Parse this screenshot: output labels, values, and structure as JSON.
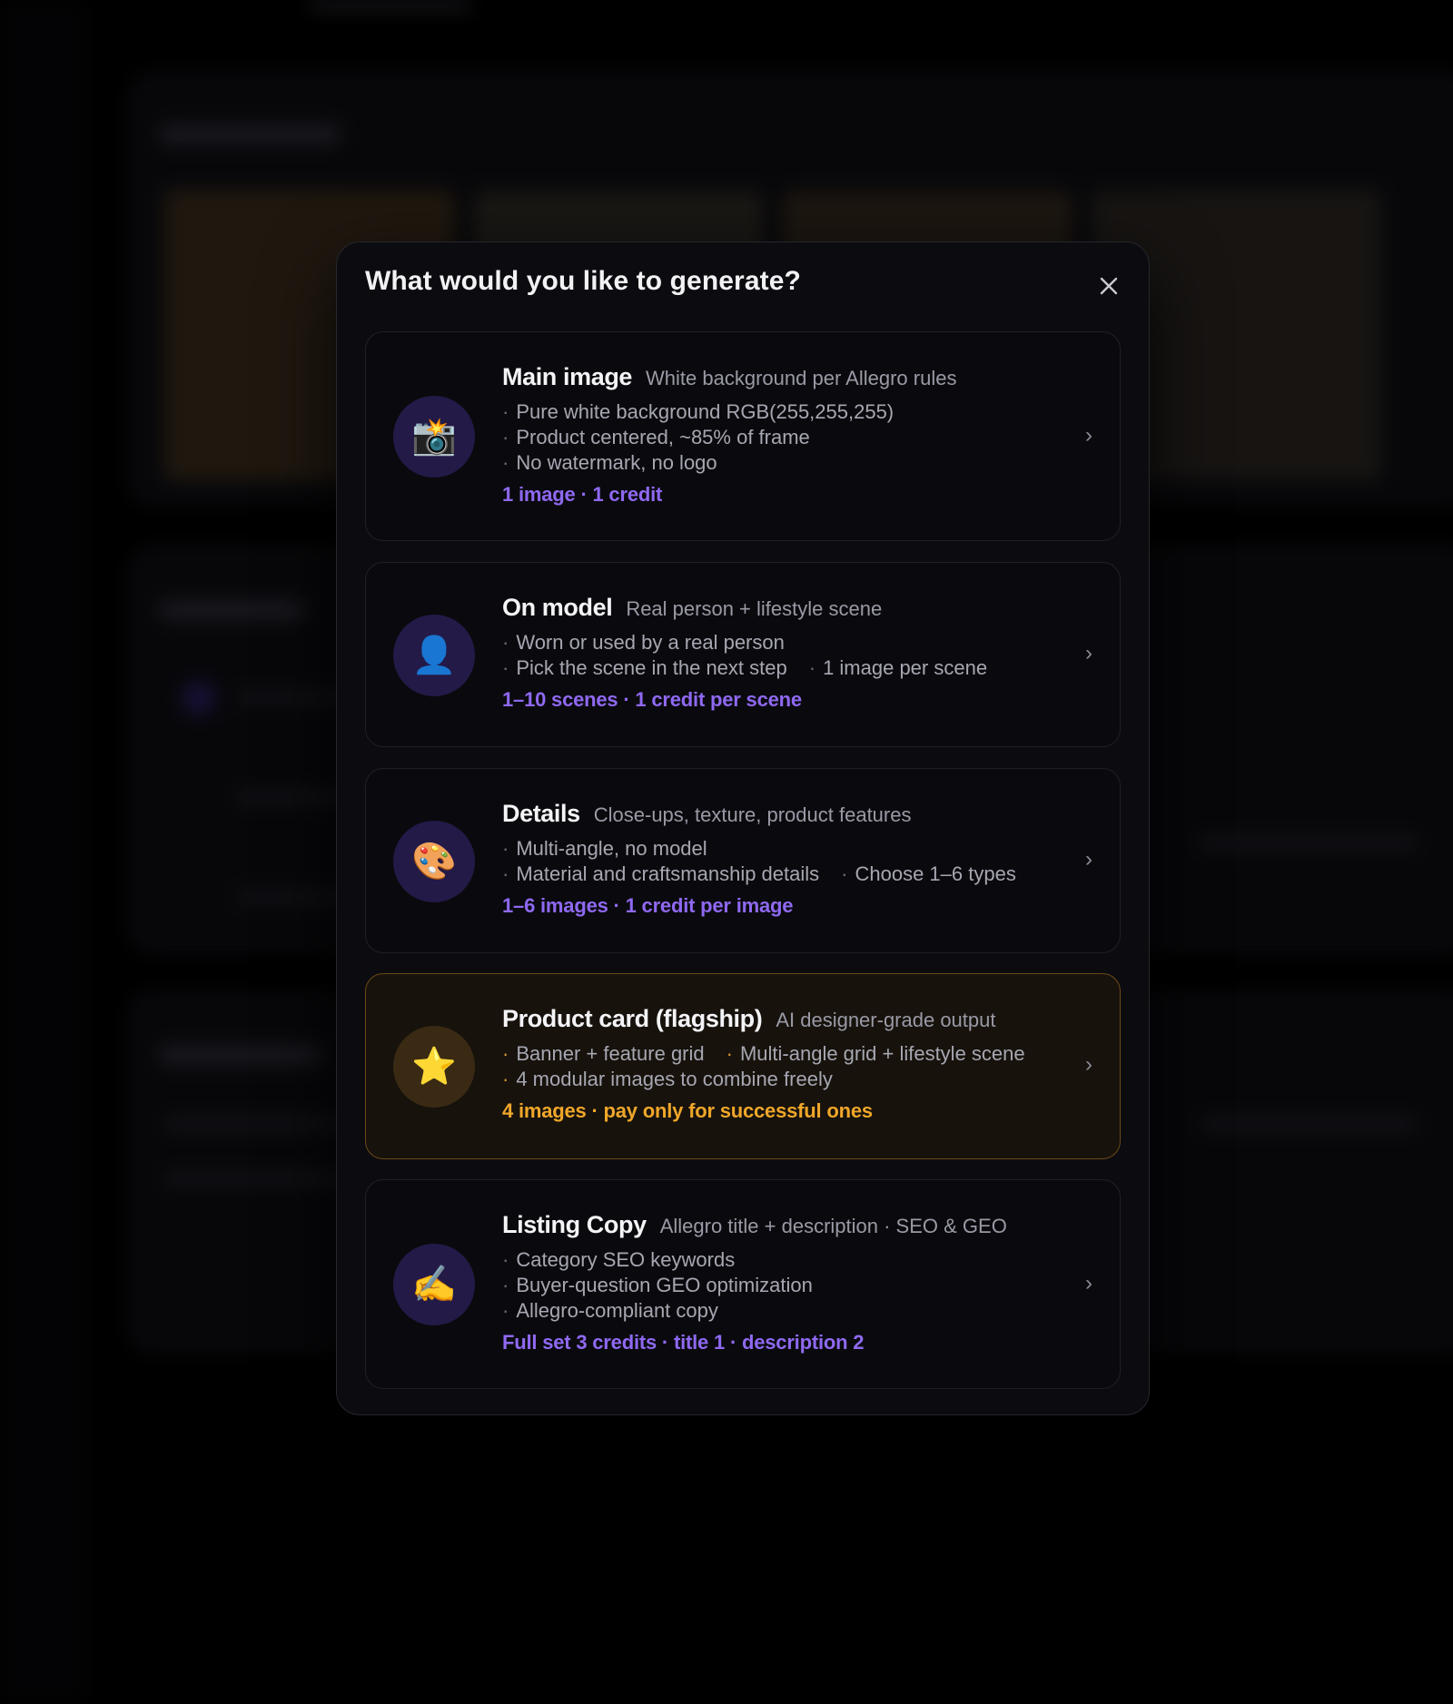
{
  "dialog": {
    "title": "What would you like to generate?"
  },
  "options": [
    {
      "title": "Main image",
      "subtitle": "White background per Allegro rules",
      "icon": "camera-flash-icon",
      "icon_glyph": "📸",
      "bullets": [
        [
          "Pure white background RGB(255,255,255)"
        ],
        [
          "Product centered, ~85% of frame"
        ],
        [
          "No watermark, no logo"
        ]
      ],
      "price": "1 image · 1 credit",
      "chevron": "›"
    },
    {
      "title": "On model",
      "subtitle": "Real person + lifestyle scene",
      "icon": "person-silhouette-icon",
      "icon_glyph": "👤",
      "bullets": [
        [
          "Worn or used by a real person"
        ],
        [
          "Pick the scene in the next step",
          "1 image per scene"
        ]
      ],
      "price": "1–10 scenes · 1 credit per scene",
      "chevron": "›"
    },
    {
      "title": "Details",
      "subtitle": "Close-ups, texture, product features",
      "icon": "palette-icon",
      "icon_glyph": "🎨",
      "bullets": [
        [
          "Multi-angle, no model"
        ],
        [
          "Material and craftsmanship details",
          "Choose 1–6 types"
        ]
      ],
      "price": "1–6 images · 1 credit per image",
      "chevron": "›"
    },
    {
      "title": "Product card (flagship)",
      "subtitle": "AI designer-grade output",
      "icon": "star-icon",
      "icon_glyph": "⭐",
      "bullets": [
        [
          "Banner + feature grid",
          "Multi-angle grid + lifestyle scene"
        ],
        [
          "4 modular images to combine freely"
        ]
      ],
      "price": "4 images · pay only for successful ones",
      "chevron": "›"
    },
    {
      "title": "Listing Copy",
      "subtitle": "Allegro title + description · SEO & GEO",
      "icon": "writing-hand-icon",
      "icon_glyph": "✍️",
      "bullets": [
        [
          "Category SEO keywords"
        ],
        [
          "Buyer-question GEO optimization"
        ],
        [
          "Allegro-compliant copy"
        ]
      ],
      "price": "Full set 3 credits · title 1 · description 2",
      "chevron": "›"
    }
  ],
  "colors": {
    "accent_purple": "#8f69f2",
    "accent_amber": "#f0a72a",
    "modal_bg": "#0c0c10"
  }
}
